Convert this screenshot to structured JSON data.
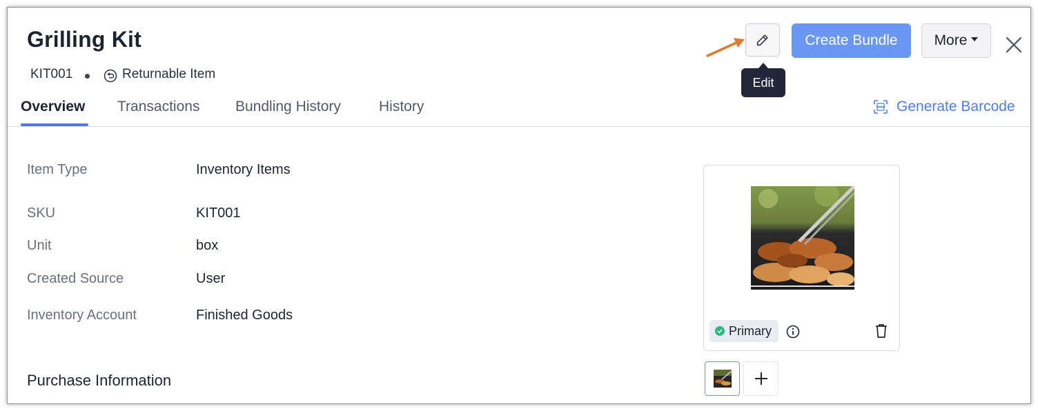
{
  "header": {
    "title": "Grilling Kit",
    "sku": "KIT001",
    "returnable_label": "Returnable Item"
  },
  "toolbar": {
    "edit_icon": "pencil-icon",
    "edit_tooltip": "Edit",
    "create_bundle_label": "Create Bundle",
    "more_label": "More",
    "close_icon": "close-icon",
    "accent_color": "#6a96f4"
  },
  "tabs": [
    {
      "label": "Overview",
      "active": true
    },
    {
      "label": "Transactions",
      "active": false
    },
    {
      "label": "Bundling History",
      "active": false
    },
    {
      "label": "History",
      "active": false
    }
  ],
  "generate_barcode_label": "Generate Barcode",
  "details": [
    {
      "label": "Item Type",
      "value": "Inventory Items"
    },
    {
      "label": "SKU",
      "value": "KIT001"
    },
    {
      "label": "Unit",
      "value": "box"
    },
    {
      "label": "Created Source",
      "value": "User"
    },
    {
      "label": "Inventory Account",
      "value": "Finished Goods"
    }
  ],
  "purchase_section_title": "Purchase Information",
  "image_card": {
    "primary_label": "Primary",
    "status_color": "#2eb87e"
  }
}
